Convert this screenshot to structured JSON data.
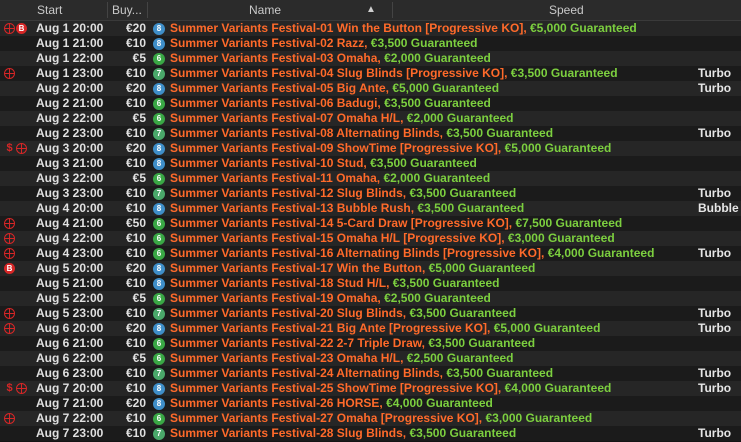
{
  "header": {
    "start": "Start",
    "buyin": "Buy...",
    "name": "Name",
    "sort_icon": "▲",
    "speed": "Speed"
  },
  "rows": [
    {
      "icons": [
        "target",
        "bounty"
      ],
      "date": "Aug 1 20:00",
      "buyin": "€20",
      "badge": "8",
      "name": "Summer Variants Festival-01 Win the Button [Progressive KO],",
      "gtd": "€5,000 Guaranteed",
      "speed": ""
    },
    {
      "icons": [],
      "date": "Aug 1 21:00",
      "buyin": "€10",
      "badge": "8",
      "name": "Summer Variants Festival-02 Razz,",
      "gtd": "€3,500 Guaranteed",
      "speed": ""
    },
    {
      "icons": [],
      "date": "Aug 1 22:00",
      "buyin": "€5",
      "badge": "6",
      "name": "Summer Variants Festival-03 Omaha,",
      "gtd": "€2,000 Guaranteed",
      "speed": ""
    },
    {
      "icons": [
        "target"
      ],
      "date": "Aug 1 23:00",
      "buyin": "€10",
      "badge": "7",
      "name": "Summer Variants Festival-04 Slug Blinds [Progressive KO],",
      "gtd": "€3,500 Guaranteed",
      "speed": "Turbo"
    },
    {
      "icons": [],
      "date": "Aug 2 20:00",
      "buyin": "€20",
      "badge": "8",
      "name": "Summer Variants Festival-05 Big Ante,",
      "gtd": "€5,000 Guaranteed",
      "speed": "Turbo"
    },
    {
      "icons": [],
      "date": "Aug 2 21:00",
      "buyin": "€10",
      "badge": "6",
      "name": "Summer Variants Festival-06 Badugi,",
      "gtd": "€3,500 Guaranteed",
      "speed": ""
    },
    {
      "icons": [],
      "date": "Aug 2 22:00",
      "buyin": "€5",
      "badge": "6",
      "name": "Summer Variants Festival-07 Omaha H/L,",
      "gtd": "€2,000 Guaranteed",
      "speed": ""
    },
    {
      "icons": [],
      "date": "Aug 2 23:00",
      "buyin": "€10",
      "badge": "7",
      "name": "Summer Variants Festival-08 Alternating Blinds,",
      "gtd": "€3,500 Guaranteed",
      "speed": "Turbo"
    },
    {
      "icons": [
        "dollar",
        "target"
      ],
      "date": "Aug 3 20:00",
      "buyin": "€20",
      "badge": "8",
      "name": "Summer Variants Festival-09 ShowTime [Progressive KO],",
      "gtd": "€5,000 Guaranteed",
      "speed": ""
    },
    {
      "icons": [],
      "date": "Aug 3 21:00",
      "buyin": "€10",
      "badge": "8",
      "name": "Summer Variants Festival-10 Stud,",
      "gtd": "€3,500 Guaranteed",
      "speed": ""
    },
    {
      "icons": [],
      "date": "Aug 3 22:00",
      "buyin": "€5",
      "badge": "6",
      "name": "Summer Variants Festival-11 Omaha,",
      "gtd": "€2,000 Guaranteed",
      "speed": ""
    },
    {
      "icons": [],
      "date": "Aug 3 23:00",
      "buyin": "€10",
      "badge": "7",
      "name": "Summer Variants Festival-12 Slug Blinds,",
      "gtd": "€3,500 Guaranteed",
      "speed": "Turbo"
    },
    {
      "icons": [],
      "date": "Aug 4 20:00",
      "buyin": "€10",
      "badge": "8",
      "name": "Summer Variants Festival-13 Bubble Rush,",
      "gtd": "€3,500 Guaranteed",
      "speed": "Bubble Rus"
    },
    {
      "icons": [
        "target"
      ],
      "date": "Aug 4 21:00",
      "buyin": "€50",
      "badge": "6",
      "name": "Summer Variants Festival-14 5-Card Draw [Progressive KO],",
      "gtd": "€7,500 Guaranteed",
      "speed": ""
    },
    {
      "icons": [
        "target"
      ],
      "date": "Aug 4 22:00",
      "buyin": "€10",
      "badge": "6",
      "name": "Summer Variants Festival-15 Omaha H/L [Progressive KO],",
      "gtd": "€3,000 Guaranteed",
      "speed": ""
    },
    {
      "icons": [
        "target"
      ],
      "date": "Aug 4 23:00",
      "buyin": "€10",
      "badge": "6",
      "name": "Summer Variants Festival-16 Alternating Blinds [Progressive KO],",
      "gtd": "€4,000 Guaranteed",
      "speed": "Turbo"
    },
    {
      "icons": [
        "bounty"
      ],
      "date": "Aug 5 20:00",
      "buyin": "€20",
      "badge": "8",
      "name": "Summer Variants Festival-17 Win the Button,",
      "gtd": "€5,000 Guaranteed",
      "speed": ""
    },
    {
      "icons": [],
      "date": "Aug 5 21:00",
      "buyin": "€10",
      "badge": "8",
      "name": "Summer Variants Festival-18 Stud H/L,",
      "gtd": "€3,500 Guaranteed",
      "speed": ""
    },
    {
      "icons": [],
      "date": "Aug 5 22:00",
      "buyin": "€5",
      "badge": "6",
      "name": "Summer Variants Festival-19 Omaha,",
      "gtd": "€2,500 Guaranteed",
      "speed": ""
    },
    {
      "icons": [
        "target"
      ],
      "date": "Aug 5 23:00",
      "buyin": "€10",
      "badge": "7",
      "name": "Summer Variants Festival-20 Slug Blinds,",
      "gtd": "€3,500 Guaranteed",
      "speed": "Turbo"
    },
    {
      "icons": [
        "target"
      ],
      "date": "Aug 6 20:00",
      "buyin": "€20",
      "badge": "8",
      "name": "Summer Variants Festival-21 Big Ante [Progressive KO],",
      "gtd": "€5,000 Guaranteed",
      "speed": "Turbo"
    },
    {
      "icons": [],
      "date": "Aug 6 21:00",
      "buyin": "€10",
      "badge": "6",
      "name": "Summer Variants Festival-22 2-7 Triple Draw,",
      "gtd": "€3,500 Guaranteed",
      "speed": ""
    },
    {
      "icons": [],
      "date": "Aug 6 22:00",
      "buyin": "€5",
      "badge": "6",
      "name": "Summer Variants Festival-23 Omaha H/L,",
      "gtd": "€2,500 Guaranteed",
      "speed": ""
    },
    {
      "icons": [],
      "date": "Aug 6 23:00",
      "buyin": "€10",
      "badge": "7",
      "name": "Summer Variants Festival-24 Alternating Blinds,",
      "gtd": "€3,500 Guaranteed",
      "speed": "Turbo"
    },
    {
      "icons": [
        "dollar",
        "target"
      ],
      "date": "Aug 7 20:00",
      "buyin": "€10",
      "badge": "8",
      "name": "Summer Variants Festival-25 ShowTime [Progressive KO],",
      "gtd": "€4,000 Guaranteed",
      "speed": "Turbo"
    },
    {
      "icons": [],
      "date": "Aug 7 21:00",
      "buyin": "€20",
      "badge": "8",
      "name": "Summer Variants Festival-26 HORSE,",
      "gtd": "€4,000 Guaranteed",
      "speed": ""
    },
    {
      "icons": [
        "target"
      ],
      "date": "Aug 7 22:00",
      "buyin": "€10",
      "badge": "6",
      "name": "Summer Variants Festival-27 Omaha [Progressive KO],",
      "gtd": "€3,000 Guaranteed",
      "speed": ""
    },
    {
      "icons": [],
      "date": "Aug 7 23:00",
      "buyin": "€10",
      "badge": "7",
      "name": "Summer Variants Festival-28 Slug Blinds,",
      "gtd": "€3,500 Guaranteed",
      "speed": "Turbo"
    }
  ]
}
